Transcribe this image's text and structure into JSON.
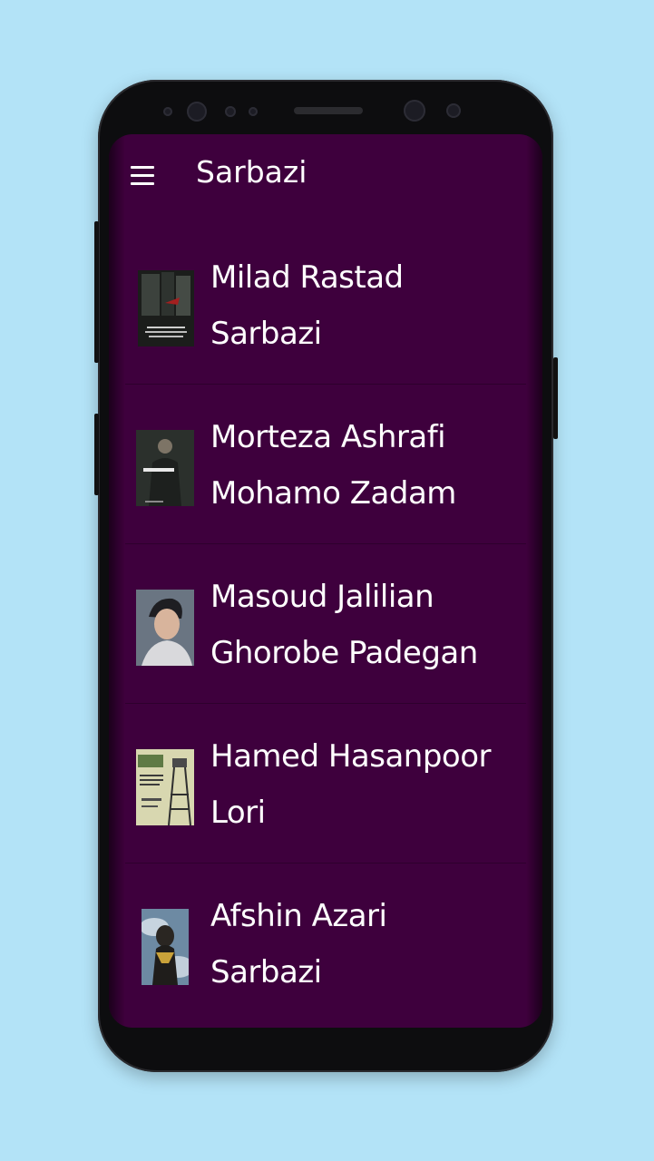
{
  "app": {
    "title": "Sarbazi"
  },
  "songs": [
    {
      "artist": "Milad Rastad",
      "title": "Sarbazi"
    },
    {
      "artist": "Morteza Ashrafi",
      "title": "Mohamo Zadam"
    },
    {
      "artist": "Masoud Jalilian",
      "title": "Ghorobe Padegan"
    },
    {
      "artist": "Hamed Hasanpoor",
      "title": "Lori"
    },
    {
      "artist": "Afshin Azari",
      "title": "Sarbazi"
    }
  ],
  "colors": {
    "background": "#b3e3f7",
    "screen": "#3e003d",
    "text": "#ffffff"
  },
  "icons": {
    "menu": "hamburger-menu-icon"
  }
}
